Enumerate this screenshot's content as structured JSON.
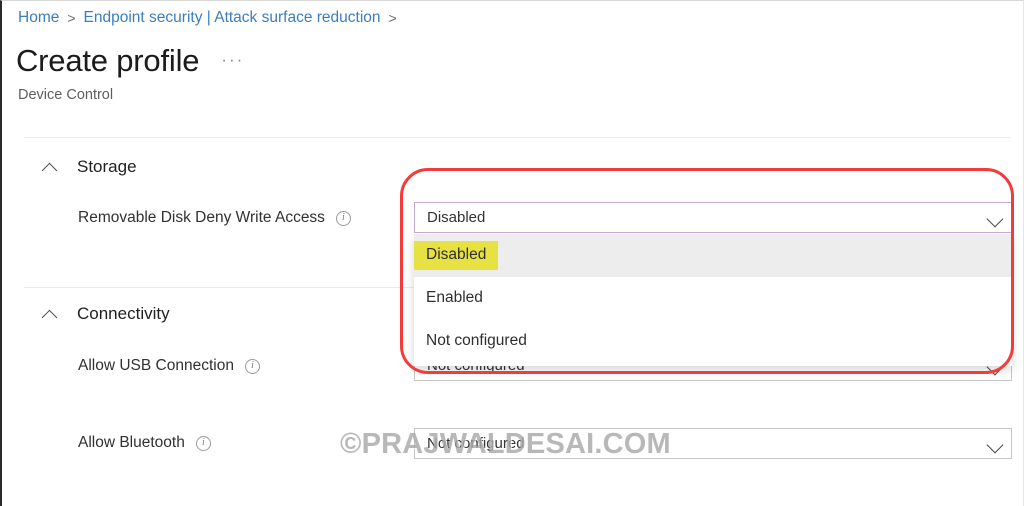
{
  "breadcrumb": {
    "items": [
      {
        "label": "Home",
        "link": true
      },
      {
        "label": "Endpoint security | Attack surface reduction",
        "link": true
      }
    ],
    "separator": ">"
  },
  "header": {
    "title": "Create profile",
    "more_label": "···",
    "subtitle": "Device Control"
  },
  "sections": [
    {
      "id": "storage",
      "title": "Storage",
      "collapse_icon": "chevron-up-icon"
    },
    {
      "id": "connectivity",
      "title": "Connectivity",
      "collapse_icon": "chevron-up-icon"
    }
  ],
  "settings": {
    "removable_disk": {
      "label": "Removable Disk Deny Write Access",
      "info_icon": "info-icon",
      "info_glyph": "i",
      "value": "Disabled",
      "chevron_icon": "chevron-down-icon",
      "expanded": true,
      "options": [
        {
          "label": "Disabled",
          "highlighted": true
        },
        {
          "label": "Enabled",
          "highlighted": false
        },
        {
          "label": "Not configured",
          "highlighted": false
        }
      ]
    },
    "allow_usb": {
      "label": "Allow USB Connection",
      "info_icon": "info-icon",
      "info_glyph": "i",
      "value": "Not configured",
      "chevron_icon": "chevron-down-icon"
    },
    "allow_bluetooth": {
      "label": "Allow Bluetooth",
      "info_icon": "info-icon",
      "info_glyph": "i",
      "value": "Not configured",
      "chevron_icon": "chevron-down-icon"
    }
  },
  "annotation": {
    "shape": "rounded-rectangle",
    "color": "#f23b3b"
  },
  "watermark": {
    "text": "©PRAJWALDESAI.COM"
  },
  "colors": {
    "link": "#3a7ebf",
    "focus_border": "#c7a8d4",
    "highlight_yellow": "#e7e143",
    "hover_row": "#ededed",
    "annotation_red": "#f23b3b"
  }
}
